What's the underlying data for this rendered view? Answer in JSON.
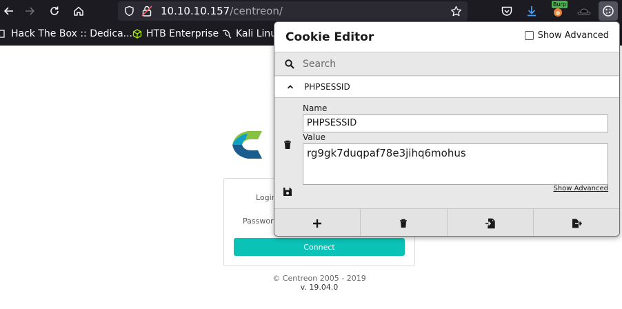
{
  "browser": {
    "url_host": "10.10.10.157",
    "url_path": "/centreon/",
    "burp_badge": "Burp"
  },
  "bookmarks": [
    {
      "label": "Hack The Box :: Dedica..."
    },
    {
      "label": "HTB Enterprise"
    },
    {
      "label": "Kali Linux"
    }
  ],
  "login": {
    "login_label": "Login",
    "password_label": "Password",
    "connect_label": "Connect",
    "copyright": "© Centreon 2005 - 2019",
    "version": "v. 19.04.0"
  },
  "cookie_editor": {
    "title": "Cookie Editor",
    "show_advanced_top": "Show Advanced",
    "search_placeholder": "Search",
    "cookie_name_header": "PHPSESSID",
    "name_label": "Name",
    "name_value": "PHPSESSID",
    "value_label": "Value",
    "value_value": "rg9gk7duqpaf78e3jihq6mohus",
    "show_advanced_link": "Show Advanced",
    "actions": [
      "add",
      "delete-all",
      "import",
      "export"
    ]
  },
  "colors": {
    "toolbar_bg": "#1c1b22",
    "urlbar_bg": "#2b2a33",
    "connect_button": "#0ac2b6",
    "popup_bg": "#e8e8e8"
  }
}
